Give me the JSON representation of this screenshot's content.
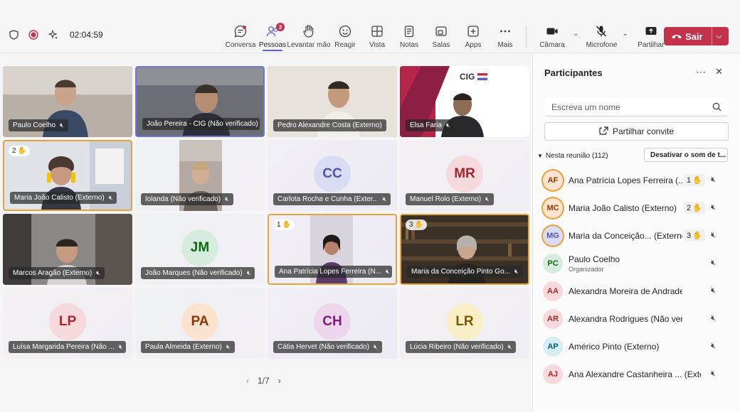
{
  "topbar": {
    "timer": "02:04:59",
    "tools": [
      {
        "label": "Conversa",
        "icon": "chat-icon"
      },
      {
        "label": "Pessoas",
        "icon": "people-icon",
        "badge": "3",
        "active": true
      },
      {
        "label": "Levantar mão",
        "icon": "raise-hand-icon"
      },
      {
        "label": "Reagir",
        "icon": "smile-icon"
      },
      {
        "label": "Vista",
        "icon": "view-icon"
      },
      {
        "label": "Notas",
        "icon": "notes-icon"
      },
      {
        "label": "Salas",
        "icon": "rooms-icon"
      },
      {
        "label": "Apps",
        "icon": "apps-icon"
      },
      {
        "label": "Mais",
        "icon": "more-icon"
      }
    ],
    "camera_label": "Câmara",
    "mic_label": "Microfone",
    "share_label": "Partilhar",
    "leave_label": "Sair",
    "leave_color": "#c4314b"
  },
  "grid": {
    "tiles": [
      {
        "name": "Paulo Coelho",
        "type": "video"
      },
      {
        "name": "João Pereira - CIG (Não verificado)",
        "type": "video",
        "selected": true
      },
      {
        "name": "Pedro Alexandre Costa (Externo)",
        "type": "video"
      },
      {
        "name": "Elsa Faria",
        "type": "video",
        "logo": "CIG"
      },
      {
        "name": "Maria João Calisto (Externo)",
        "type": "video",
        "hand": "2"
      },
      {
        "name": "Iolanda (Não verificado)",
        "type": "video"
      },
      {
        "name": "Carlota Rocha e Cunha (Exter...",
        "type": "avatar",
        "initials": "CC",
        "color": "#d9dcf2",
        "text_color": "#4f52b2"
      },
      {
        "name": "Manuel Rolo (Externo)",
        "type": "avatar",
        "initials": "MR",
        "color": "#f6d9dc",
        "text_color": "#a4262c"
      },
      {
        "name": "Marcos Aragão (Externo)",
        "type": "video"
      },
      {
        "name": "João Marques (Não verificado)",
        "type": "avatar",
        "initials": "JM",
        "color": "#d6ecdf",
        "text_color": "#0b6a0b"
      },
      {
        "name": "Ana Patrícia Lopes Ferreira (N...",
        "type": "video",
        "hand": "1"
      },
      {
        "name": "Maria da Conceição Pinto Go...",
        "type": "video",
        "hand": "3"
      },
      {
        "name": "Luísa Margarida Pereira (Não ...",
        "type": "avatar",
        "initials": "LP",
        "color": "#f6d9dc",
        "text_color": "#a4262c"
      },
      {
        "name": "Paula Almeida (Externo)",
        "type": "avatar",
        "initials": "PA",
        "color": "#fbe3cf",
        "text_color": "#8a3707"
      },
      {
        "name": "Cátia Hervet (Não verificado)",
        "type": "avatar",
        "initials": "CH",
        "color": "#ecd6ec",
        "text_color": "#7f1b7f"
      },
      {
        "name": "Lúcia Ribeiro (Não verificado)",
        "type": "avatar",
        "initials": "LR",
        "color": "#f9efc6",
        "text_color": "#7a5a00"
      }
    ],
    "page": "1/7"
  },
  "sidebar": {
    "title": "Participantes",
    "search_placeholder": "Escreva um nome",
    "share_invite": "Partilhar convite",
    "section_label": "Nesta reunião (112)",
    "mute_all": "Desativar o som de t...",
    "participants": [
      {
        "initials": "AF",
        "name": "Ana Patrícia Lopes Ferreira (...",
        "hand": "1",
        "ring": true,
        "color": "#fbe3cf",
        "text_color": "#8a3707"
      },
      {
        "initials": "MC",
        "name": "Maria João Calisto (Externo)",
        "hand": "2",
        "ring": true,
        "color": "#fbe3cf",
        "text_color": "#8a3707"
      },
      {
        "initials": "MG",
        "name": "Maria da Conceição... (Externo)",
        "hand": "3",
        "ring": true,
        "color": "#d9dcf2",
        "text_color": "#4f52b2"
      },
      {
        "initials": "PC",
        "name": "Paulo Coelho",
        "role": "Organizador",
        "color": "#d6ecdf",
        "text_color": "#0b6a0b"
      },
      {
        "initials": "AA",
        "name": "Alexandra Moreira de Andrade",
        "color": "#f6d9dc",
        "text_color": "#a4262c"
      },
      {
        "initials": "AR",
        "name": "Alexandra Rodrigues (Não verificado)",
        "color": "#f6d9dc",
        "text_color": "#a4262c"
      },
      {
        "initials": "AP",
        "name": "Américo Pinto (Externo)",
        "color": "#d6eef2",
        "text_color": "#005b70"
      },
      {
        "initials": "AJ",
        "name": "Ana Alexandre Castanheira ... (Externo)",
        "color": "#f6d9dc",
        "text_color": "#a4262c"
      }
    ]
  }
}
